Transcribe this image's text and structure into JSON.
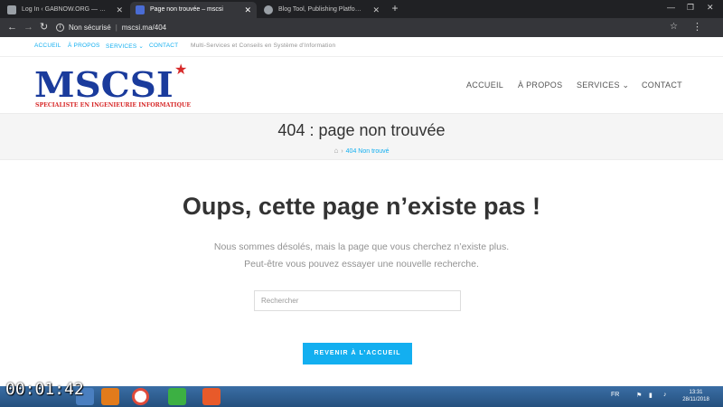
{
  "browser": {
    "tabs": [
      {
        "title": "Log In ‹ GABNOW.ORG — WordPress",
        "active": false,
        "favicon_color": "#9aa0a6"
      },
      {
        "title": "Page non trouvée – mscsi",
        "active": true,
        "favicon_color": "#4a6cd4"
      },
      {
        "title": "Blog Tool, Publishing Platform, and CMS",
        "active": false,
        "favicon_color": "#9aa0a6"
      }
    ],
    "security_label": "Non sécurisé",
    "url": "mscsi.ma/404"
  },
  "site": {
    "topbar": {
      "links": [
        "ACCUEIL",
        "À PROPOS",
        "SERVICES ⌄",
        "CONTACT"
      ],
      "tagline": "Multi-Services et Conseils en Système d'Information"
    },
    "logo": {
      "name": "MSCSI",
      "subtitle": "SPECIALISTE EN INGENIEURIE INFORMATIQUE",
      "colors": {
        "primary": "#1a3b9c",
        "accent": "#d72a2a"
      }
    },
    "nav": [
      "ACCUEIL",
      "À PROPOS",
      "SERVICES ⌄",
      "CONTACT"
    ],
    "page_title": "404 : page non trouvée",
    "breadcrumb": {
      "current": "404 Non trouvé"
    },
    "error": {
      "heading": "Oups, cette page n’existe pas !",
      "line1": "Nous sommes désolés, mais la page que vous cherchez n’existe plus.",
      "line2": "Peut-être vous pouvez essayer une nouvelle recherche."
    },
    "search": {
      "placeholder": "Rechercher"
    },
    "home_button": "REVENIR À L’ACCUEIL",
    "accent_color": "#13aff0"
  },
  "taskbar": {
    "language": "FR",
    "time": "13:31",
    "date": "28/11/2018"
  },
  "overlay": {
    "timer": "00:01:42"
  }
}
